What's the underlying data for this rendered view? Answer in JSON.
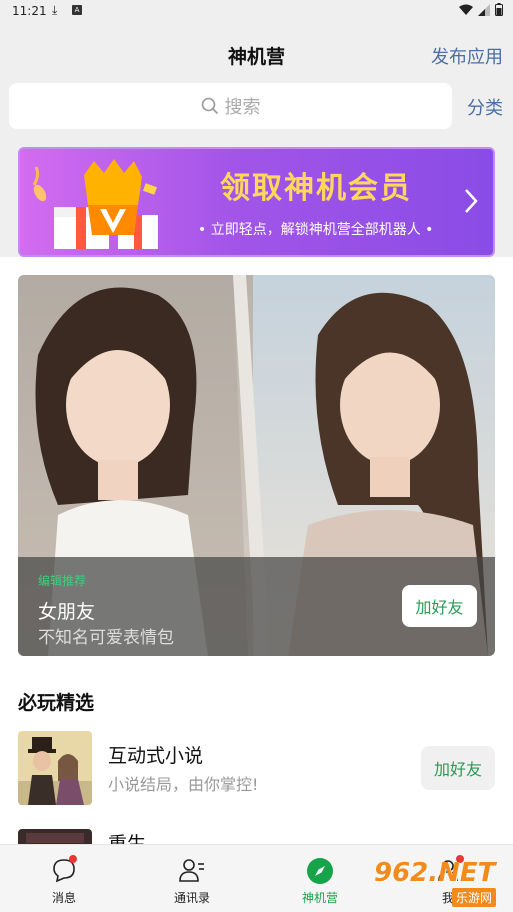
{
  "status_bar": {
    "time": "11:21"
  },
  "header": {
    "title": "神机营",
    "publish_label": "发布应用",
    "search_placeholder": "搜索",
    "category_label": "分类"
  },
  "banner": {
    "title": "领取神机会员",
    "subtitle": "• 立即轻点，解锁神机营全部机器人 •"
  },
  "feature": {
    "tag": "编辑推荐",
    "name": "女朋友",
    "description": "不知名可爱表情包",
    "add_label": "加好友"
  },
  "section": {
    "title": "必玩精选"
  },
  "items": [
    {
      "name": "互动式小说",
      "description": "小说结局，由你掌控!",
      "add_label": "加好友"
    },
    {
      "name": "重生",
      "description": "",
      "add_label": ""
    }
  ],
  "tabs": [
    {
      "label": "消息",
      "icon": "chat-icon"
    },
    {
      "label": "通讯录",
      "icon": "contacts-icon"
    },
    {
      "label": "神机营",
      "icon": "compass-icon",
      "active": true
    },
    {
      "label": "我",
      "icon": "profile-icon"
    }
  ],
  "watermark": {
    "brand": "962.NET",
    "sub": "乐游网"
  },
  "colors": {
    "accent_green": "#16a34a",
    "link_blue": "#4a6fa5",
    "banner_purple": "#a255e8",
    "badge_red": "#e53935"
  }
}
